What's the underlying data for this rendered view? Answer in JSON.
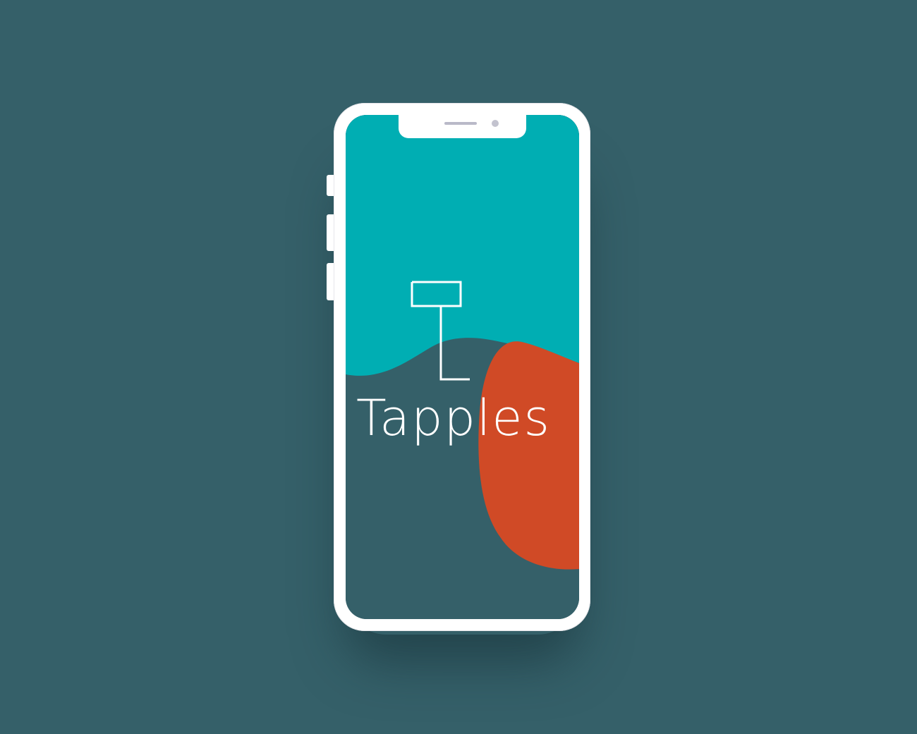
{
  "app": {
    "name": "Tapples",
    "logo_icon": "tapples-t-logo-icon"
  },
  "device": {
    "type": "smartphone-mockup",
    "frame_color": "#ffffff"
  },
  "colors": {
    "page_background": "#356069",
    "screen_top": "#00AEB3",
    "screen_bottom": "#356069",
    "accent_blob": "#D04A26",
    "text": "#ffffff"
  }
}
